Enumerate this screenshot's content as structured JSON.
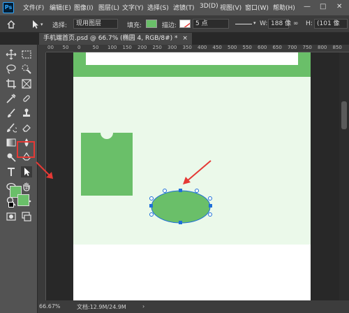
{
  "app": {
    "logo_text": "Ps",
    "menu": [
      "文件(F)",
      "编辑(E)",
      "图像(I)",
      "图层(L)",
      "文字(Y)",
      "选择(S)",
      "滤镜(T)",
      "3D(D)",
      "视图(V)",
      "窗口(W)",
      "帮助(H)"
    ],
    "window_controls": {
      "minimize": "—",
      "maximize": "□",
      "close": "✕"
    }
  },
  "options": {
    "select_label": "选择:",
    "select_value": "现用图层",
    "fill_label": "填充:",
    "fill_color": "#6abf69",
    "stroke_label": "描边:",
    "stroke_width": "5 点",
    "w_label": "W:",
    "w_value": "188 像",
    "h_label": "H:",
    "h_value": "(101 像"
  },
  "document": {
    "tab_title": "手机端首页.psd @ 66.7% (椭圆 4, RGB/8#) *",
    "tab_close": "×"
  },
  "ruler": {
    "ticks": [
      "00",
      "50",
      "0",
      "50",
      "100",
      "150",
      "200",
      "250",
      "300",
      "350",
      "400",
      "450",
      "500",
      "550",
      "600",
      "650",
      "700",
      "750",
      "800",
      "850"
    ]
  },
  "status": {
    "zoom": "66.67%",
    "doc_info": "文档:12.9M/24.9M"
  },
  "colors": {
    "accent_green": "#6abf69",
    "light_green": "#ebf9ea",
    "annotation_red": "#e53935",
    "selection_blue": "#1e6fd9"
  },
  "tools": [
    "move-tool-icon",
    "marquee-tool-icon",
    "lasso-tool-icon",
    "quick-select-tool-icon",
    "crop-tool-icon",
    "frame-tool-icon",
    "eyedropper-tool-icon",
    "healing-tool-icon",
    "brush-tool-icon",
    "stamp-tool-icon",
    "history-brush-tool-icon",
    "eraser-tool-icon",
    "gradient-tool-icon",
    "blur-tool-icon",
    "dodge-tool-icon",
    "pen-tool-icon",
    "type-tool-icon",
    "path-selection-tool-icon",
    "ellipse-tool-icon",
    "hand-tool-icon",
    "zoom-tool-icon",
    "more-tools-icon"
  ]
}
